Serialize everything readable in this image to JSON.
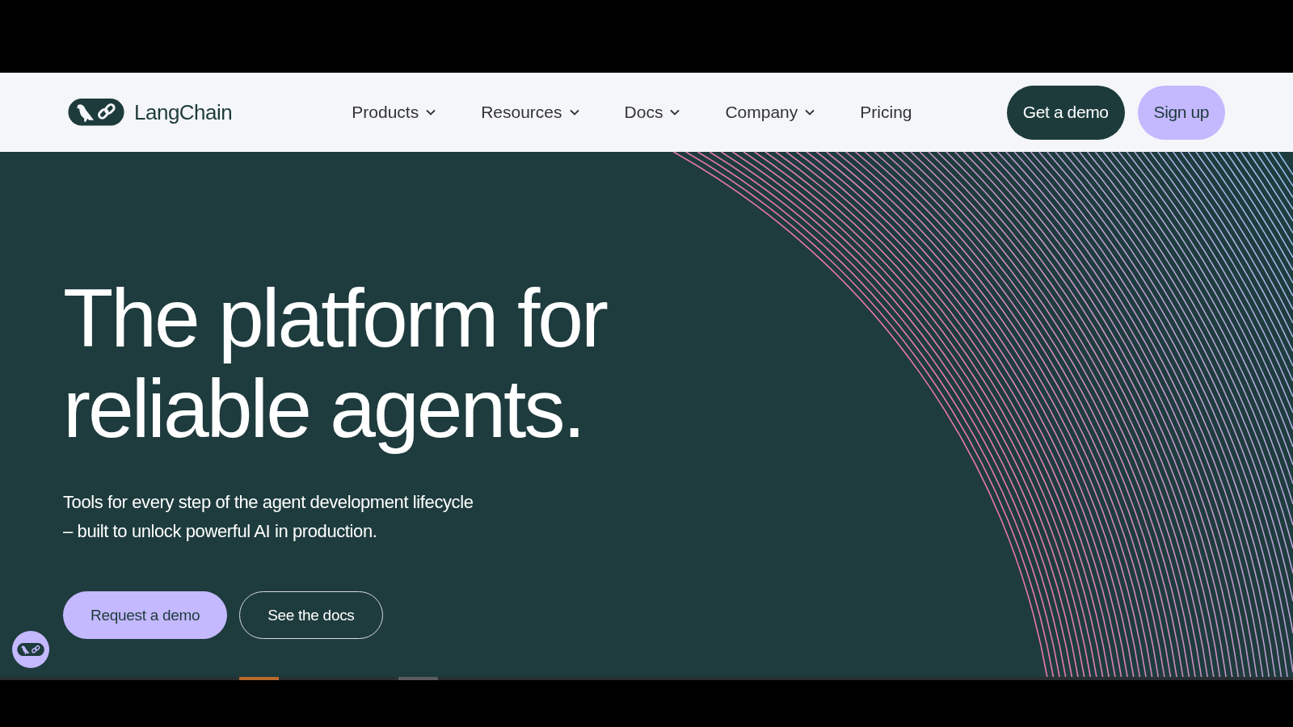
{
  "header": {
    "brand": "LangChain",
    "nav": [
      {
        "label": "Products",
        "dropdown": true
      },
      {
        "label": "Resources",
        "dropdown": true
      },
      {
        "label": "Docs",
        "dropdown": true
      },
      {
        "label": "Company",
        "dropdown": true
      },
      {
        "label": "Pricing",
        "dropdown": false
      }
    ],
    "buttons": [
      {
        "label": "Get a demo",
        "kind": "dark"
      },
      {
        "label": "Sign up",
        "kind": "light"
      }
    ]
  },
  "hero": {
    "title_lines": [
      "The platform for",
      "reliable agents."
    ],
    "subtitle_lines": [
      "Tools for every step of the agent development lifecycle",
      "– built to unlock powerful AI in production."
    ],
    "buttons": [
      {
        "label": "Request a demo",
        "kind": "filled"
      },
      {
        "label": "See the docs",
        "kind": "outline"
      }
    ]
  }
}
